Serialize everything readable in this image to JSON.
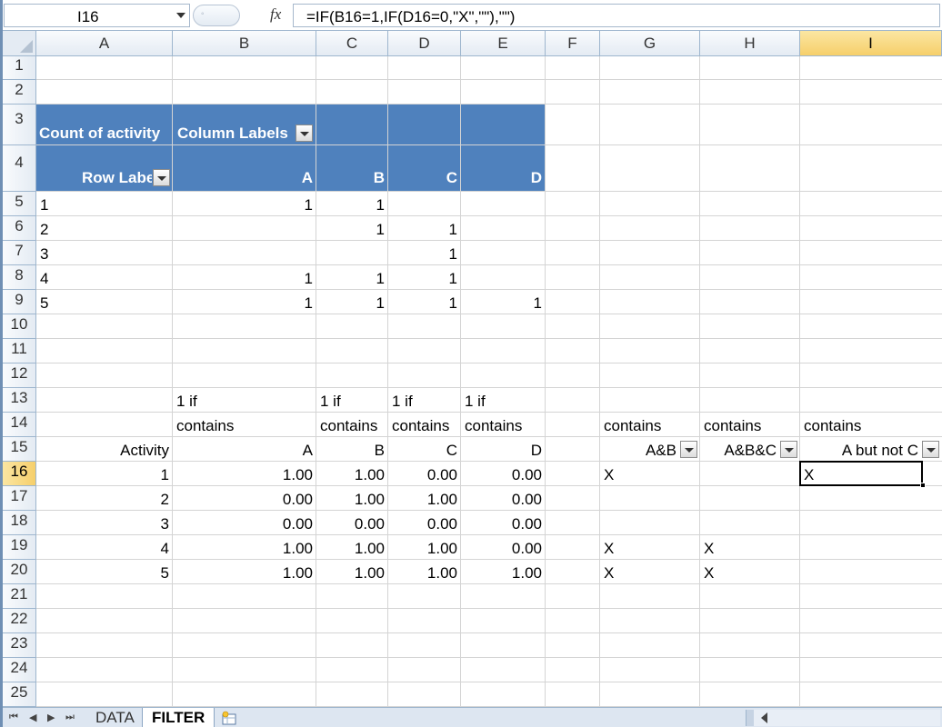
{
  "formula_bar": {
    "name_box": "I16",
    "fx": "fx",
    "formula": "=IF(B16=1,IF(D16=0,\"X\",\"\"),\"\")"
  },
  "columns": [
    "A",
    "B",
    "C",
    "D",
    "E",
    "F",
    "G",
    "H",
    "I"
  ],
  "rows": [
    "1",
    "2",
    "3",
    "4",
    "5",
    "6",
    "7",
    "8",
    "9",
    "10",
    "11",
    "12",
    "13",
    "14",
    "15",
    "16",
    "17",
    "18",
    "19",
    "20",
    "21",
    "22",
    "23",
    "24",
    "25"
  ],
  "pivot": {
    "value_field": "Count of activity",
    "column_labels": "Column Labels",
    "row_labels": "Row Labels",
    "col_headers": [
      "A",
      "B",
      "C",
      "D"
    ],
    "rows": [
      {
        "label": "1",
        "A": "1",
        "B": "1",
        "C": "",
        "D": ""
      },
      {
        "label": "2",
        "A": "",
        "B": "1",
        "C": "1",
        "D": ""
      },
      {
        "label": "3",
        "A": "",
        "B": "",
        "C": "1",
        "D": ""
      },
      {
        "label": "4",
        "A": "1",
        "B": "1",
        "C": "1",
        "D": ""
      },
      {
        "label": "5",
        "A": "1",
        "B": "1",
        "C": "1",
        "D": "1"
      }
    ]
  },
  "table": {
    "hdr13": {
      "B": "1 if",
      "C": "1 if",
      "D": "1 if",
      "E": "1 if"
    },
    "hdr14": {
      "B": "contains",
      "C": "contains",
      "D": "contains",
      "E": "contains",
      "G": "contains",
      "H": "contains",
      "I": "contains"
    },
    "hdr15": {
      "A": "Activity",
      "B": "A",
      "C": "B",
      "D": "C",
      "E": "D",
      "G": "A&B",
      "H": "A&B&C",
      "I": "A but not C"
    },
    "rows": [
      {
        "A": "1",
        "B": "1.00",
        "C": "1.00",
        "D": "0.00",
        "E": "0.00",
        "G": "X",
        "H": "",
        "I": "X"
      },
      {
        "A": "2",
        "B": "0.00",
        "C": "1.00",
        "D": "1.00",
        "E": "0.00",
        "G": "",
        "H": "",
        "I": ""
      },
      {
        "A": "3",
        "B": "0.00",
        "C": "0.00",
        "D": "0.00",
        "E": "0.00",
        "G": "",
        "H": "",
        "I": ""
      },
      {
        "A": "4",
        "B": "1.00",
        "C": "1.00",
        "D": "1.00",
        "E": "0.00",
        "G": "X",
        "H": "X",
        "I": ""
      },
      {
        "A": "5",
        "B": "1.00",
        "C": "1.00",
        "D": "1.00",
        "E": "1.00",
        "G": "X",
        "H": "X",
        "I": ""
      }
    ]
  },
  "sheets": {
    "tab1": "DATA",
    "tab2": "FILTER",
    "active": "FILTER"
  },
  "colors": {
    "pivot_header": "#4f81bd",
    "selected_header": "#f6cf6b",
    "gridline": "#d4d4d4",
    "header_border": "#9eb6ce"
  }
}
